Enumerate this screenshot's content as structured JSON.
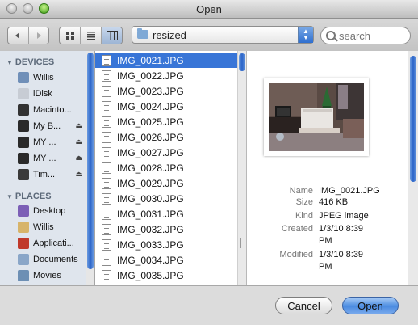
{
  "window": {
    "title": "Open"
  },
  "toolbar": {
    "location": "resized",
    "search_placeholder": "search"
  },
  "sidebar": {
    "devices_label": "DEVICES",
    "places_label": "PLACES",
    "devices": [
      {
        "label": "Willis",
        "icon": "computer-icon",
        "color": "#6f8fb8"
      },
      {
        "label": "iDisk",
        "icon": "idisk-icon",
        "color": "#c7ccd4"
      },
      {
        "label": "Macinto...",
        "icon": "hard-drive-icon",
        "color": "#333333"
      },
      {
        "label": "My B...",
        "icon": "external-drive-icon",
        "color": "#2a2a2a",
        "eject": true
      },
      {
        "label": "MY ...",
        "icon": "external-drive-icon",
        "color": "#2a2a2a",
        "eject": true
      },
      {
        "label": "MY ...",
        "icon": "external-drive-icon",
        "color": "#2a2a2a",
        "eject": true
      },
      {
        "label": "Tim...",
        "icon": "time-machine-icon",
        "color": "#3a3a3a",
        "eject": true
      }
    ],
    "places": [
      {
        "label": "Desktop",
        "icon": "desktop-icon",
        "color": "#7c5fb6"
      },
      {
        "label": "Willis",
        "icon": "home-icon",
        "color": "#d7b46a"
      },
      {
        "label": "Applicati...",
        "icon": "applications-icon",
        "color": "#c0392b"
      },
      {
        "label": "Documents",
        "icon": "documents-icon",
        "color": "#8aa6c8"
      },
      {
        "label": "Movies",
        "icon": "movies-icon",
        "color": "#6d8fb4"
      }
    ]
  },
  "files": [
    "IMG_0021.JPG",
    "IMG_0022.JPG",
    "IMG_0023.JPG",
    "IMG_0024.JPG",
    "IMG_0025.JPG",
    "IMG_0026.JPG",
    "IMG_0027.JPG",
    "IMG_0028.JPG",
    "IMG_0029.JPG",
    "IMG_0030.JPG",
    "IMG_0031.JPG",
    "IMG_0032.JPG",
    "IMG_0033.JPG",
    "IMG_0034.JPG",
    "IMG_0035.JPG"
  ],
  "selected_file": "IMG_0021.JPG",
  "preview": {
    "name_label": "Name",
    "name": "IMG_0021.JPG",
    "size_label": "Size",
    "size": "416 KB",
    "kind_label": "Kind",
    "kind": "JPEG image",
    "created_label": "Created",
    "created_1": "1/3/10 8:39",
    "created_2": "PM",
    "modified_label": "Modified",
    "modified_1": "1/3/10 8:39",
    "modified_2": "PM"
  },
  "buttons": {
    "cancel": "Cancel",
    "open": "Open"
  },
  "colors": {
    "selection": "#3875d7",
    "default_button": "#4a8be0"
  }
}
